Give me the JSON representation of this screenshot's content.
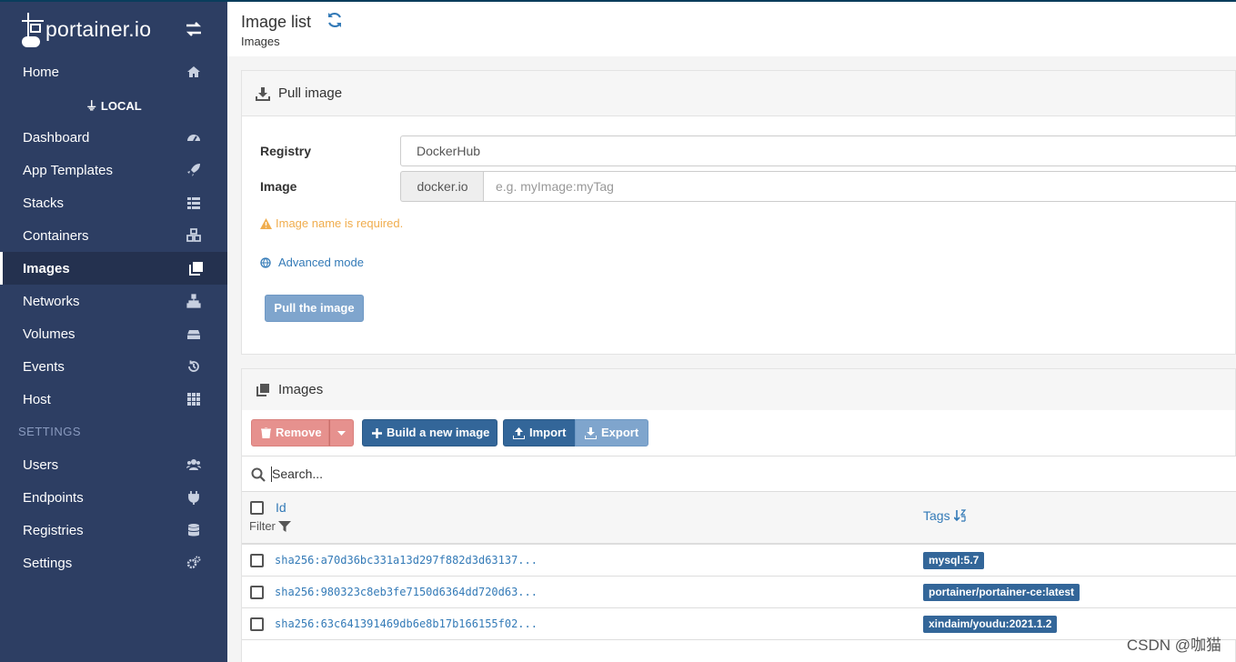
{
  "sidebar": {
    "logo_text": "portainer.io",
    "home_label": "Home",
    "local_label": "LOCAL",
    "items": [
      {
        "label": "Dashboard"
      },
      {
        "label": "App Templates"
      },
      {
        "label": "Stacks"
      },
      {
        "label": "Containers"
      },
      {
        "label": "Images"
      },
      {
        "label": "Networks"
      },
      {
        "label": "Volumes"
      },
      {
        "label": "Events"
      },
      {
        "label": "Host"
      }
    ],
    "settings_title": "SETTINGS",
    "settings_items": [
      {
        "label": "Users"
      },
      {
        "label": "Endpoints"
      },
      {
        "label": "Registries"
      },
      {
        "label": "Settings"
      }
    ]
  },
  "header": {
    "title": "Image list",
    "breadcrumb": "Images"
  },
  "pull": {
    "heading": "Pull image",
    "registry_label": "Registry",
    "registry_value": "DockerHub",
    "image_label": "Image",
    "image_prefix": "docker.io",
    "image_placeholder": "e.g. myImage:myTag",
    "warning": "Image name is required.",
    "advanced_mode": "Advanced mode",
    "pull_button": "Pull the image"
  },
  "images": {
    "heading": "Images",
    "remove_button": "Remove",
    "build_button": "Build a new image",
    "import_button": "Import",
    "export_button": "Export",
    "search_placeholder": "Search...",
    "col_id": "Id",
    "col_filter": "Filter",
    "col_tags": "Tags",
    "rows": [
      {
        "id": "sha256:a70d36bc331a13d297f882d3d63137...",
        "tag": "mysql:5.7"
      },
      {
        "id": "sha256:980323c8eb3fe7150d6364dd720d63...",
        "tag": "portainer/portainer-ce:latest"
      },
      {
        "id": "sha256:63c641391469db6e8b17b166155f02...",
        "tag": "xindaim/youdu:2021.1.2"
      }
    ]
  },
  "watermark": "CSDN @咖猫",
  "colors": {
    "sidebar_bg": "#2d3e63",
    "primary": "#336699",
    "link": "#337ab7",
    "danger_light": "#e6918e",
    "warning": "#f0ad4e"
  }
}
